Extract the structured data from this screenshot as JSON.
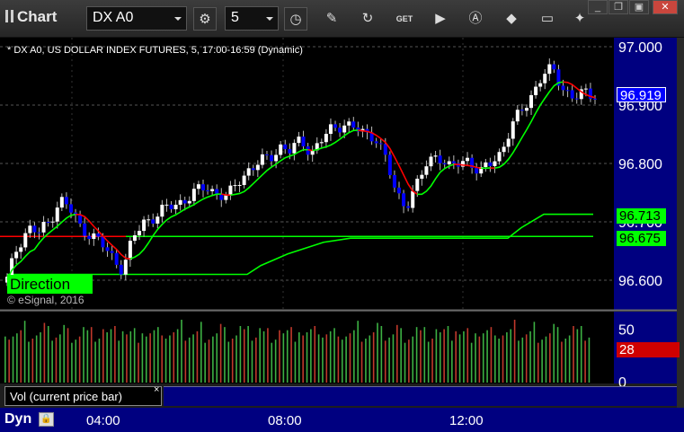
{
  "toolbar": {
    "app_title": "Chart",
    "symbol": "DX A0",
    "interval": "5",
    "icons": [
      "settings-gear-icon",
      "clock-icon",
      "pencil-draw-icon",
      "refresh-icon",
      "get-data-icon",
      "play-icon",
      "alert-icon",
      "tag-icon",
      "comment-icon",
      "twitter-bird-icon"
    ],
    "get_label": "GET",
    "window_buttons": {
      "minimize": "_",
      "restore": "❐",
      "close": "✕"
    }
  },
  "chart": {
    "study_title": "* DX A0, US DOLLAR INDEX FUTURES, 5, 17:00-16:59 (Dynamic)",
    "direction_label": "Direction",
    "copyright": "© eSignal, 2016",
    "price_axis": {
      "ticks": [
        {
          "label": "97.000",
          "value": 97.0
        },
        {
          "label": "96.900",
          "value": 96.9
        },
        {
          "label": "96.800",
          "value": 96.8
        },
        {
          "label": "96.700",
          "value": 96.7
        },
        {
          "label": "96.600",
          "value": 96.6
        }
      ]
    },
    "price_tags": {
      "last": "96.919",
      "upper_line": "96.713",
      "lower_line": "96.675"
    },
    "volume_axis": {
      "ticks": [
        {
          "label": "50",
          "value": 50
        },
        {
          "label": "0",
          "value": 0
        }
      ]
    },
    "volume_tag": "28",
    "volume_panel_label": "Vol (current price bar)",
    "time_labels": [
      "04:00",
      "08:00",
      "12:00"
    ],
    "bottom_label": "Dyn",
    "colors": {
      "up_candle": "#ffffff",
      "down_candle": "#0000ff",
      "ma_green": "#00ff00",
      "ma_red": "#ff0000",
      "vol_up": "#3cb043",
      "vol_down": "#c0392b",
      "axis_panel": "#000080"
    }
  },
  "chart_data": {
    "type": "candlestick",
    "x_labels": [
      "04:00",
      "08:00",
      "12:00"
    ],
    "ylim": [
      96.58,
      97.03
    ],
    "close_path": [
      96.6,
      96.66,
      96.69,
      96.68,
      96.7,
      96.74,
      96.72,
      96.69,
      96.68,
      96.66,
      96.64,
      96.62,
      96.67,
      96.7,
      96.71,
      96.72,
      96.73,
      96.74,
      96.75,
      96.76,
      96.75,
      96.74,
      96.77,
      96.79,
      96.8,
      96.81,
      96.83,
      96.82,
      96.84,
      96.82,
      96.84,
      96.86,
      96.87,
      96.86,
      96.85,
      96.85,
      96.81,
      96.75,
      96.73,
      96.76,
      96.8,
      96.82,
      96.79,
      96.8,
      96.81,
      96.78,
      96.8,
      96.82,
      96.86,
      96.89,
      96.92,
      96.95,
      96.96,
      96.93,
      96.91,
      96.92,
      96.92
    ],
    "volume_max": 60
  }
}
